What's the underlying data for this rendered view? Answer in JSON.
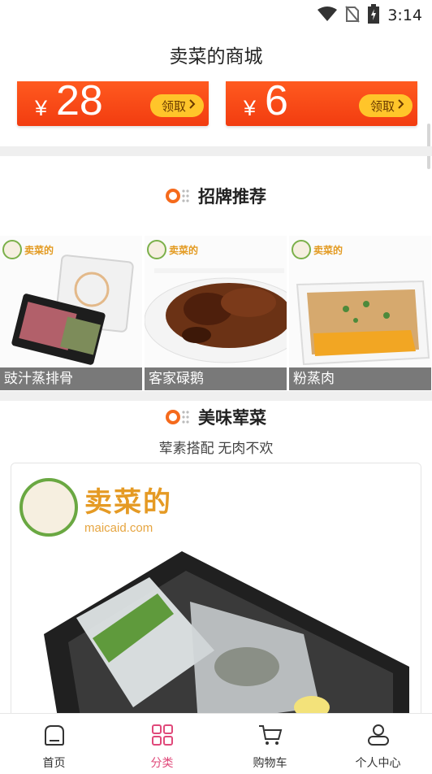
{
  "status_bar": {
    "time": "3:14"
  },
  "header": {
    "title": "卖菜的商城"
  },
  "coupons": [
    {
      "currency": "¥",
      "amount": "28",
      "button": "领取"
    },
    {
      "currency": "¥",
      "amount": "6",
      "button": "领取"
    }
  ],
  "sections": {
    "signature": {
      "title": "招牌推荐"
    },
    "veggie": {
      "title": "美味荤菜",
      "subtitle": "荤素搭配 无肉不欢"
    }
  },
  "featured": [
    {
      "caption": "豉汁蒸排骨",
      "brand": "卖菜的"
    },
    {
      "caption": "客家碌鹅",
      "brand": "卖菜的"
    },
    {
      "caption": "粉蒸肉",
      "brand": "卖菜的"
    }
  ],
  "big_card": {
    "brand": "卖菜的",
    "domain": "maicaid.com"
  },
  "nav": {
    "items": [
      {
        "label": "首页",
        "icon": "home-icon"
      },
      {
        "label": "分类",
        "icon": "category-grid-icon"
      },
      {
        "label": "购物车",
        "icon": "cart-icon"
      },
      {
        "label": "个人中心",
        "icon": "user-icon"
      }
    ],
    "active_index": 1
  },
  "colors": {
    "accent": "#f24e14",
    "coupon_button": "#ffc52a",
    "nav_active": "#e0497a"
  }
}
